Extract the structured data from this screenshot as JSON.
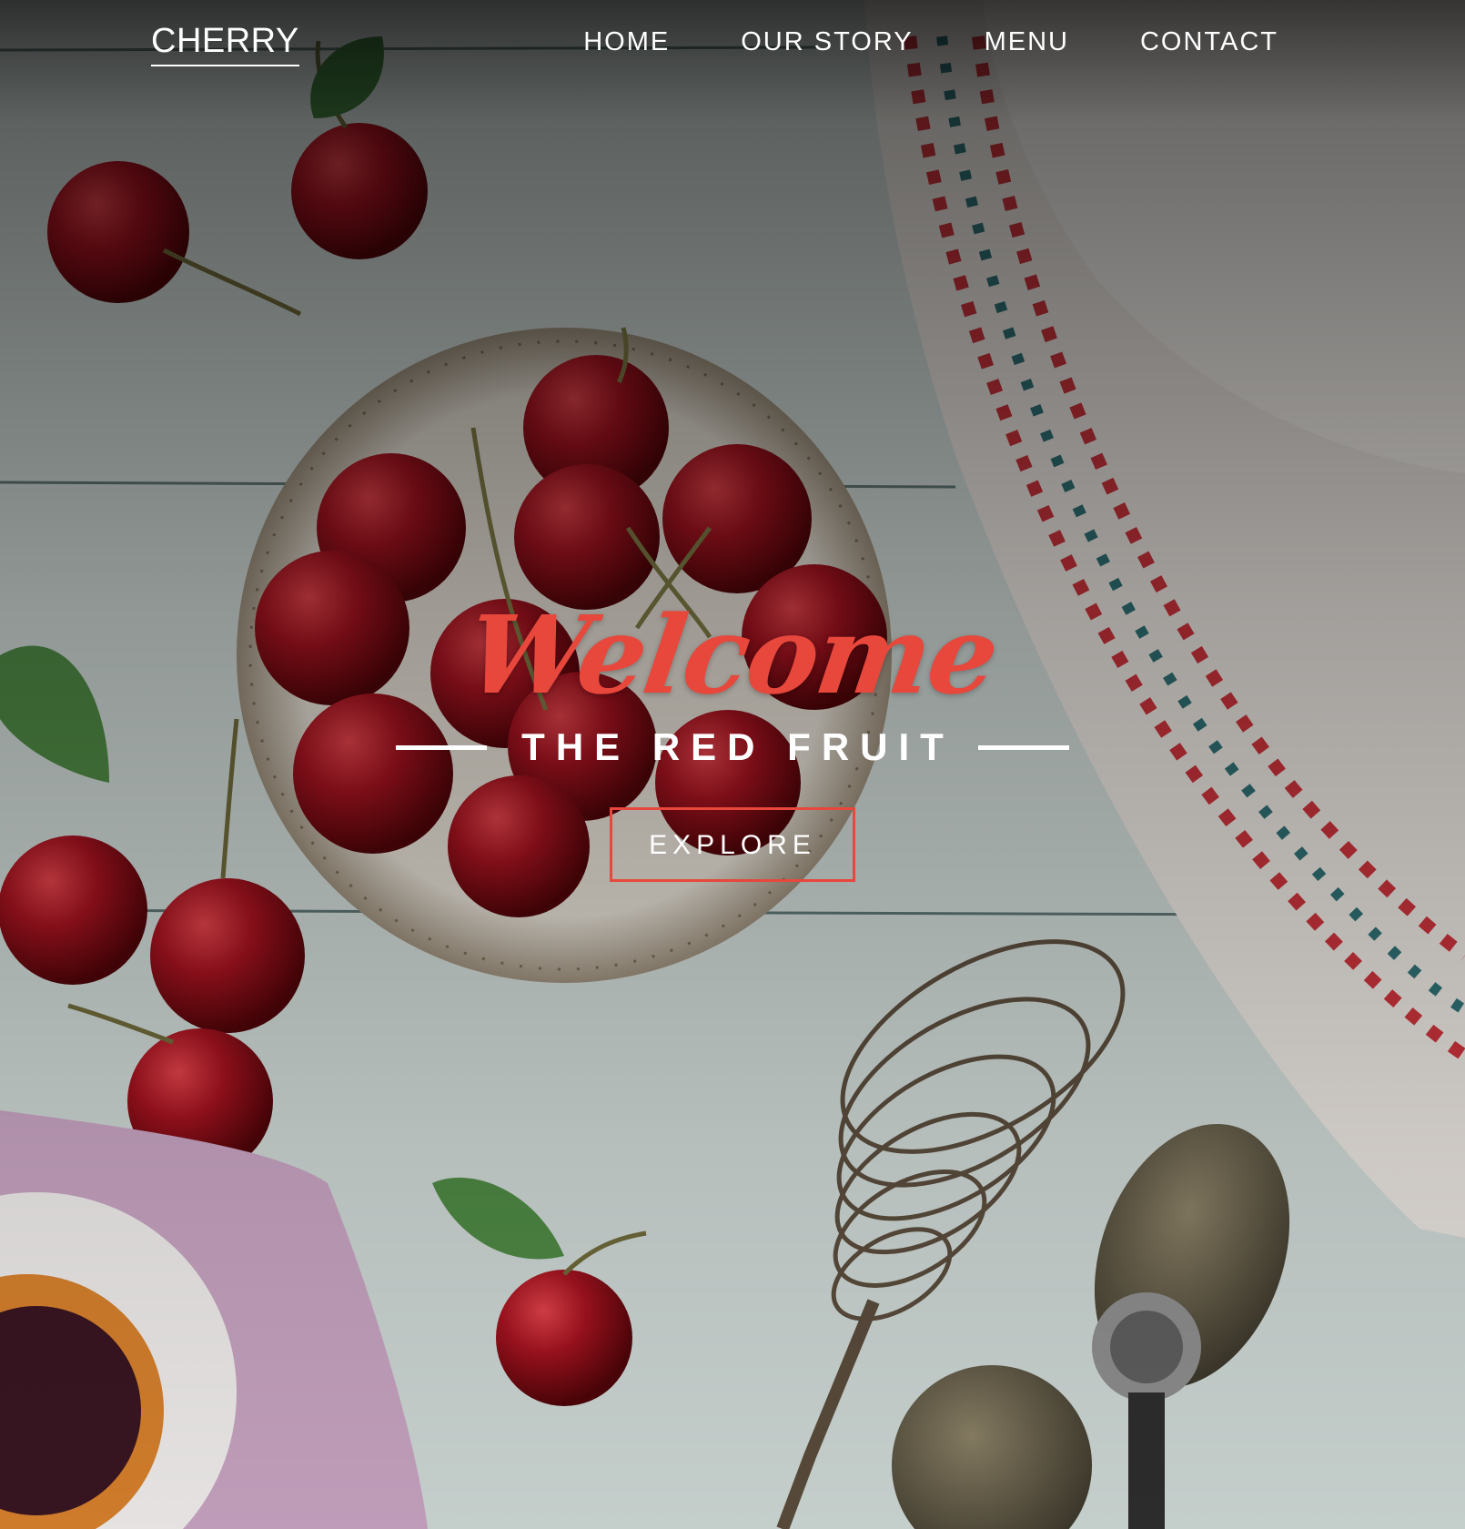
{
  "navbar": {
    "brand": "CHERRY",
    "links": [
      {
        "label": "HOME"
      },
      {
        "label": "OUR STORY"
      },
      {
        "label": "MENU"
      },
      {
        "label": "CONTACT"
      }
    ]
  },
  "hero": {
    "welcome": "Welcome",
    "subtitle": "THE RED FRUIT",
    "cta_label": "EXPLORE"
  },
  "colors": {
    "accent": "#e8473c",
    "text": "#ffffff"
  },
  "background": {
    "icon": "cherries-baking-photo"
  }
}
